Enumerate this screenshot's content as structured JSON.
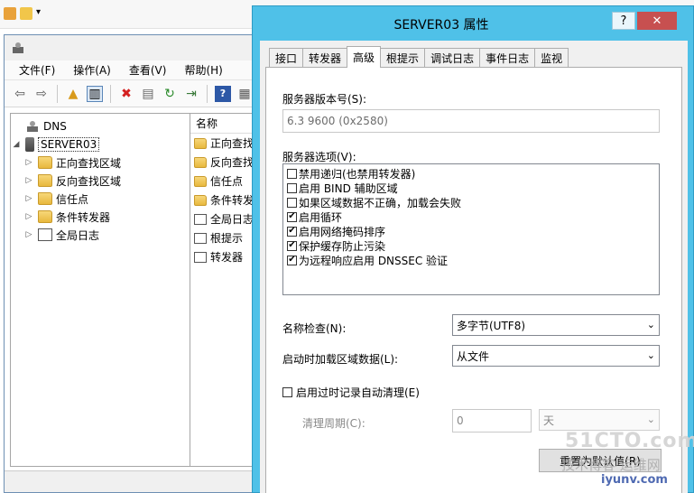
{
  "explorer": {
    "icons": [
      "note-icon",
      "folder-icon",
      "dropdown-icon"
    ]
  },
  "dns_manager": {
    "menu": [
      "文件(F)",
      "操作(A)",
      "查看(V)",
      "帮助(H)"
    ],
    "tree": {
      "root": "DNS",
      "server": "SERVER03",
      "children": [
        "正向查找区域",
        "反向查找区域",
        "信任点",
        "条件转发器",
        "全局日志"
      ]
    },
    "list": {
      "header": "名称",
      "items": [
        "正向查找",
        "反向查找",
        "信任点",
        "条件转发",
        "全局日志",
        "根提示",
        "转发器"
      ]
    }
  },
  "dialog": {
    "title": "SERVER03 属性",
    "help": "?",
    "close": "✕",
    "tabs": [
      "接口",
      "转发器",
      "高级",
      "根提示",
      "调试日志",
      "事件日志",
      "监视"
    ],
    "active_tab": "高级",
    "version_label": "服务器版本号(S):",
    "version_value": "6.3 9600 (0x2580)",
    "options_label": "服务器选项(V):",
    "options": [
      {
        "label": "禁用递归(也禁用转发器)",
        "checked": false
      },
      {
        "label": "启用 BIND 辅助区域",
        "checked": false
      },
      {
        "label": "如果区域数据不正确，加载会失败",
        "checked": false
      },
      {
        "label": "启用循环",
        "checked": true
      },
      {
        "label": "启用网络掩码排序",
        "checked": true
      },
      {
        "label": "保护缓存防止污染",
        "checked": true
      },
      {
        "label": "为远程响应启用 DNSSEC 验证",
        "checked": true
      }
    ],
    "name_check_label": "名称检查(N):",
    "name_check_value": "多字节(UTF8)",
    "load_zone_label": "启动时加载区域数据(L):",
    "load_zone_value": "从文件",
    "scavenging_label": "启用过时记录自动清理(E)",
    "scavenging_checked": false,
    "period_label": "清理周期(C):",
    "period_value": "0",
    "period_unit": "天",
    "reset_button": "重置为默认值(R)"
  },
  "watermark": {
    "line1": "51CTO.com",
    "line2": "技术博客 运维网",
    "line3": "iyunv.com"
  }
}
